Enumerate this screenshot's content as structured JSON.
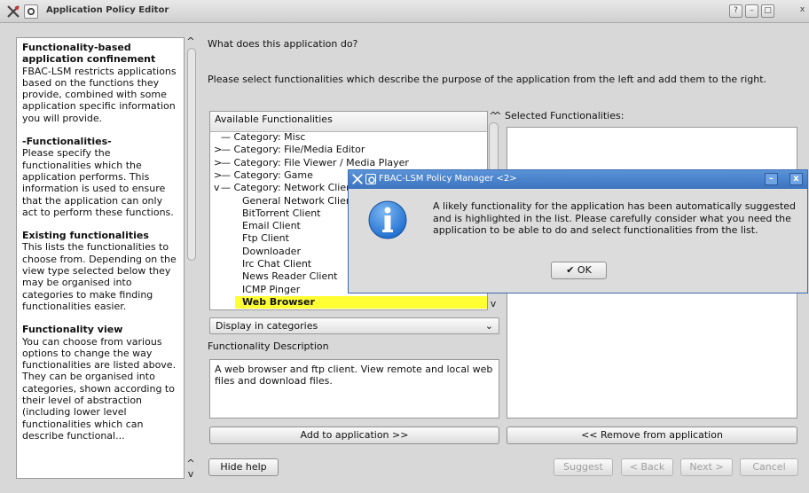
{
  "window": {
    "title": "Application Policy Editor",
    "buttons": [
      "?",
      "–",
      "□",
      "x"
    ]
  },
  "help": {
    "sections": [
      {
        "heading": "Functionality-based application confinement",
        "body": "FBAC-LSM restricts applications based on the functions they provide, combined with some application specific information you will provide."
      },
      {
        "heading": "-Functionalities-",
        "body": "Please specify the functionalities which the application performs. This information is used to ensure that the application can only act to perform these functions."
      },
      {
        "heading": "Existing functionalities",
        "body": "This lists the functionalities to choose from. Depending on the view type selected below they may be organised into categories to make finding functionalities easier."
      },
      {
        "heading": "Functionality view",
        "body": "You can choose from various options to change the way functionalities are listed above. They can be organised into categories, shown according to their level of abstraction (including lower level functionalities which can describe functional..."
      }
    ]
  },
  "main": {
    "question": "What does this application do?",
    "instruction": "Please select functionalities which describe the purpose of the application from the left and add them to the right.",
    "available_header": "Available Functionalities",
    "selected_header": "Selected Functionalities:",
    "tree": [
      {
        "indent": 0,
        "expander": "",
        "text": "Category: Misc"
      },
      {
        "indent": 0,
        "expander": ">",
        "text": "Category: File/Media Editor"
      },
      {
        "indent": 0,
        "expander": ">",
        "text": "Category: File Viewer / Media Player"
      },
      {
        "indent": 0,
        "expander": ">",
        "text": "Category: Game"
      },
      {
        "indent": 0,
        "expander": "v",
        "text": "Category: Network Client"
      },
      {
        "indent": 1,
        "expander": "",
        "text": "General Network Client"
      },
      {
        "indent": 1,
        "expander": "",
        "text": "BitTorrent Client"
      },
      {
        "indent": 1,
        "expander": "",
        "text": "Email Client"
      },
      {
        "indent": 1,
        "expander": "",
        "text": "Ftp Client"
      },
      {
        "indent": 1,
        "expander": "",
        "text": "Downloader"
      },
      {
        "indent": 1,
        "expander": "",
        "text": "Irc Chat Client"
      },
      {
        "indent": 1,
        "expander": "",
        "text": "News Reader Client"
      },
      {
        "indent": 1,
        "expander": "",
        "text": "ICMP Pinger"
      },
      {
        "indent": 1,
        "expander": "",
        "text": "Web Browser",
        "selected": true
      }
    ],
    "view_combo": "Display in categories",
    "description_label": "Functionality Description",
    "description_text": "A web browser and ftp client. View remote and local web files and download files.",
    "add_button": "Add to application >>",
    "remove_button": "<< Remove from application"
  },
  "footer": {
    "hide_help": "Hide help",
    "suggest": "Suggest",
    "back": "< Back",
    "next": "Next >",
    "cancel": "Cancel"
  },
  "dialog": {
    "title": "FBAC-LSM Policy Manager <2>",
    "message": "A likely functionality for the application has been automatically suggested and is highlighted in the list. Please carefully consider what you need the application to be able to do and select functionalities from the list.",
    "ok": "OK"
  },
  "colors": {
    "dialog_title": "#3b73bf",
    "highlight": "#ffff33",
    "info_icon": "#1f6fd0"
  }
}
